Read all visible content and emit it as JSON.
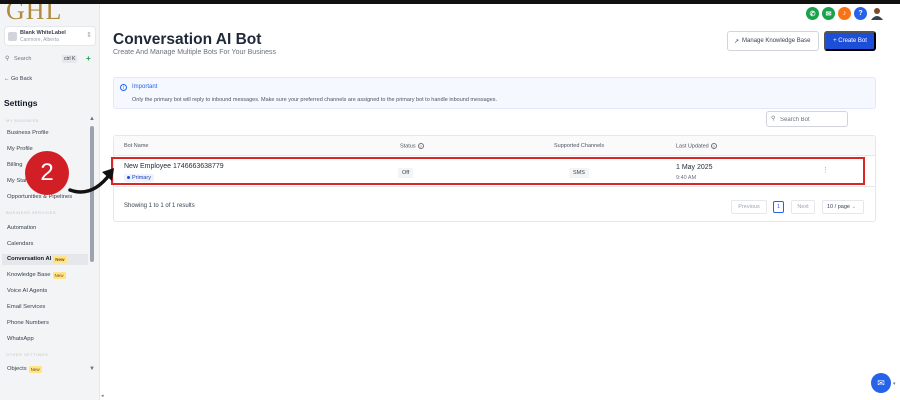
{
  "sidebar": {
    "logo": "GHL",
    "account": {
      "name": "Blank WhiteLabel",
      "location": "Canmore, Alberta"
    },
    "search": {
      "label": "Search",
      "shortcut": "ctrl K"
    },
    "go_back": "Go Back",
    "title": "Settings",
    "sections": [
      {
        "label": "MY BUSINESS"
      },
      {
        "label": "BUSINESS SERVICES"
      },
      {
        "label": "OTHER SETTINGS"
      }
    ],
    "items": [
      {
        "label": "Business Profile"
      },
      {
        "label": "My Profile"
      },
      {
        "label": "Billing"
      },
      {
        "label": "My Staff"
      },
      {
        "label": "Opportunities & Pipelines"
      },
      {
        "label": "Automation"
      },
      {
        "label": "Calendars"
      },
      {
        "label": "Conversation AI",
        "badge": "New"
      },
      {
        "label": "Knowledge Base",
        "badge": "New"
      },
      {
        "label": "Voice AI Agents"
      },
      {
        "label": "Email Services"
      },
      {
        "label": "Phone Numbers"
      },
      {
        "label": "WhatsApp"
      },
      {
        "label": "Objects",
        "badge": "New"
      }
    ]
  },
  "header": {
    "title": "Conversation AI Bot",
    "subtitle": "Create And Manage Multiple Bots For Your Business",
    "manage_kb_label": "Manage Knowledge Base",
    "create_bot_label": "+ Create Bot"
  },
  "top_icons": [
    {
      "name": "phone-icon",
      "color": "#16a34a",
      "glyph": "✆"
    },
    {
      "name": "megaphone-icon",
      "color": "#16a34a",
      "glyph": "✉"
    },
    {
      "name": "notification-icon",
      "color": "#f97316",
      "glyph": "♪"
    },
    {
      "name": "help-icon",
      "color": "#2563eb",
      "glyph": "?"
    }
  ],
  "notice": {
    "title": "Important",
    "body": "Only the primary bot will reply to inbound messages. Make sure your preferred channels are assigned to the primary bot to handle inbound messages."
  },
  "search_bot": {
    "placeholder": "Search Bot"
  },
  "table": {
    "columns": [
      "Bot Name",
      "Status",
      "Supported Channels",
      "Last Updated"
    ],
    "rows": [
      {
        "name": "New Employee 1746663638779",
        "tag": "Primary",
        "status": "Off",
        "channel": "SMS",
        "date": "1 May 2025",
        "time": "9:40 AM"
      }
    ],
    "footer": {
      "showing": "Showing 1 to 1 of 1 results",
      "prev": "Previous",
      "page": "1",
      "next": "Next",
      "page_size": "10 / page"
    }
  },
  "annotation": {
    "step": "2",
    "color": "#d21f26"
  }
}
